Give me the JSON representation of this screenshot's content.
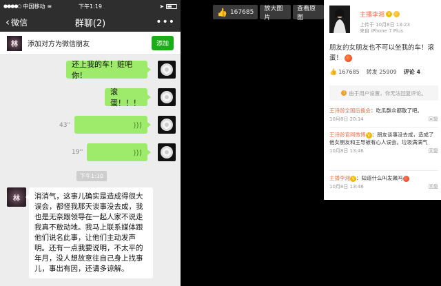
{
  "wechat": {
    "status": {
      "carrier": "中国移动",
      "time": "下午1:19",
      "battery": ""
    },
    "nav": {
      "back_label": "微信",
      "title": "群聊(2)",
      "more": "•••"
    },
    "add_friend": {
      "text": "添加对方为微信朋友",
      "button": "添加"
    },
    "messages": {
      "m1": "还上我的车！赃吧你！",
      "m2": "滚蛋！！！",
      "v1_duration": "43''",
      "v2_duration": "19''",
      "timestamp": "下午1:10",
      "reply": "消消气，这事儿确实是造成得很大误会，都怪我那天谈事没去成，我也是无奈跟领导在一起人家不说走我真不敢动地。我马上联系媒体跟他们说名此事，让他们主动发声明。还有一点我要说明，不太平的年月，没人想故意往自己身上找事儿，事出有因，还请多谅解。"
    },
    "group_avatar_glyph": "林"
  },
  "toolbar": {
    "like_count": "167685",
    "enlarge": "放大图片",
    "view_original": "查看原图"
  },
  "weibo": {
    "user_name": "主播李湘",
    "meta_line1": "上传于 10月8日 13:23",
    "meta_line2": "来自 iPhone 7 Plus",
    "post_text": "朋友的女朋友也不可以坐我的车！滚蛋！",
    "stats": {
      "likes": "167685",
      "reposts": "转发 25909",
      "comments": "评论 4"
    },
    "notice": "由于用户设置，你无法回复评论。",
    "comments": [
      {
        "user": "王诗龄全国后援会",
        "text": "：吃瓜群众都散了吧。",
        "time": "10月8日 20:14",
        "reply": "回复"
      },
      {
        "user": "王诗龄官网微博",
        "text": "：朋友谈事没去成，造成了他女朋友和王导被有心人误会。垃圾满满气",
        "time": "10月8日 13:46",
        "reply": "回复"
      },
      {
        "user": "主播李湘",
        "text": "：知道什么叫发飙吗",
        "time": "10月8日 13:46",
        "reply": "回复"
      }
    ]
  }
}
